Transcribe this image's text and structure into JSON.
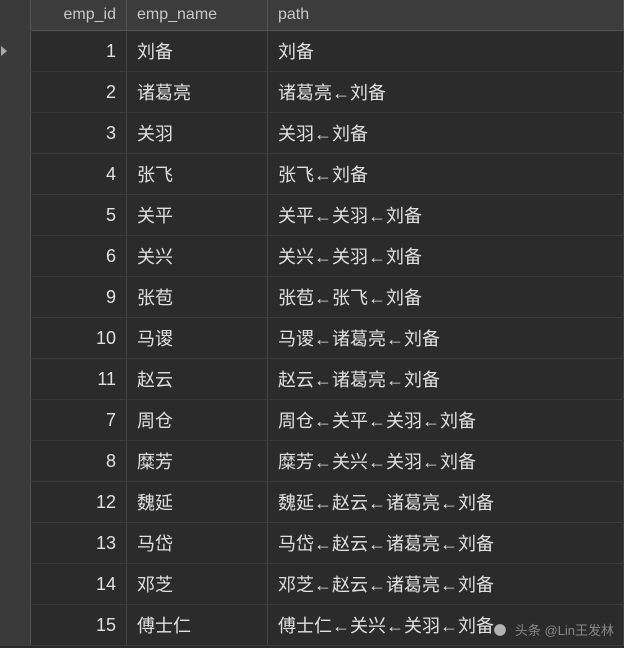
{
  "columns": {
    "id": "emp_id",
    "name": "emp_name",
    "path": "path"
  },
  "rows": [
    {
      "id": "1",
      "name": "刘备",
      "path": "刘备"
    },
    {
      "id": "2",
      "name": "诸葛亮",
      "path": "诸葛亮←刘备"
    },
    {
      "id": "3",
      "name": "关羽",
      "path": "关羽←刘备"
    },
    {
      "id": "4",
      "name": "张飞",
      "path": "张飞←刘备"
    },
    {
      "id": "5",
      "name": "关平",
      "path": "关平←关羽←刘备"
    },
    {
      "id": "6",
      "name": "关兴",
      "path": "关兴←关羽←刘备"
    },
    {
      "id": "9",
      "name": "张苞",
      "path": "张苞←张飞←刘备"
    },
    {
      "id": "10",
      "name": "马谡",
      "path": "马谡←诸葛亮←刘备"
    },
    {
      "id": "11",
      "name": "赵云",
      "path": "赵云←诸葛亮←刘备"
    },
    {
      "id": "7",
      "name": "周仓",
      "path": "周仓←关平←关羽←刘备"
    },
    {
      "id": "8",
      "name": "糜芳",
      "path": "糜芳←关兴←关羽←刘备"
    },
    {
      "id": "12",
      "name": "魏延",
      "path": "魏延←赵云←诸葛亮←刘备"
    },
    {
      "id": "13",
      "name": "马岱",
      "path": "马岱←赵云←诸葛亮←刘备"
    },
    {
      "id": "14",
      "name": "邓芝",
      "path": "邓芝←赵云←诸葛亮←刘备"
    },
    {
      "id": "15",
      "name": "傅士仁",
      "path": "傅士仁←关兴←关羽←刘备"
    }
  ],
  "watermark": {
    "text": "头条 @Lin王发林"
  }
}
